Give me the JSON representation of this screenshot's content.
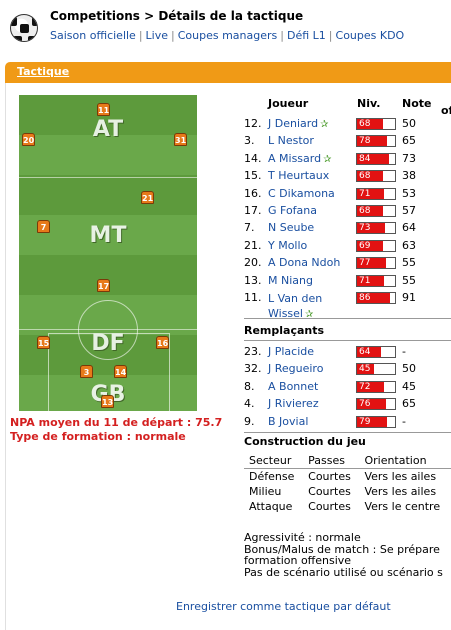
{
  "header": {
    "breadcrumb": "Competitions > Détails de la tactique",
    "nav": [
      "Saison officielle",
      "Live",
      "Coupes managers",
      "Défi L1",
      "Coupes KDO"
    ]
  },
  "tab": {
    "label": "Tactique"
  },
  "pitch": {
    "zones": [
      "AT",
      "MT",
      "DF",
      "GB"
    ],
    "shirts": [
      "11",
      "20",
      "31",
      "21",
      "7",
      "17",
      "15",
      "16",
      "3",
      "14",
      "13"
    ]
  },
  "summary": {
    "npa": "NPA moyen du 11 de départ : 75.7",
    "formation": "Type de formation : normale"
  },
  "table": {
    "headers": {
      "player": "Joueur",
      "level": "Niv.",
      "note": "Note",
      "extra": "of"
    },
    "starters": [
      {
        "num": "12.",
        "name": "J Deniard",
        "star": true,
        "level": 68,
        "note": "50"
      },
      {
        "num": "3.",
        "name": "L Nestor",
        "star": false,
        "level": 78,
        "note": "65"
      },
      {
        "num": "14.",
        "name": "A Missard",
        "star": true,
        "level": 84,
        "note": "73"
      },
      {
        "num": "15.",
        "name": "T Heurtaux",
        "star": false,
        "level": 68,
        "note": "38"
      },
      {
        "num": "16.",
        "name": "C Dikamona",
        "star": false,
        "level": 71,
        "note": "53"
      },
      {
        "num": "17.",
        "name": "G Fofana",
        "star": false,
        "level": 68,
        "note": "57"
      },
      {
        "num": "7.",
        "name": "N Seube",
        "star": false,
        "level": 73,
        "note": "64"
      },
      {
        "num": "21.",
        "name": "Y Mollo",
        "star": false,
        "level": 69,
        "note": "63"
      },
      {
        "num": "20.",
        "name": "A Dona Ndoh",
        "star": false,
        "level": 77,
        "note": "55"
      },
      {
        "num": "13.",
        "name": "M Niang",
        "star": false,
        "level": 71,
        "note": "55"
      },
      {
        "num": "11.",
        "name": "L Van den Wissel",
        "star": true,
        "level": 86,
        "note": "91"
      }
    ],
    "subs_title": "Remplaçants",
    "subs": [
      {
        "num": "23.",
        "name": "J Placide",
        "level": 64,
        "note": "-"
      },
      {
        "num": "32.",
        "name": "J Regueiro",
        "level": 45,
        "note": "50"
      },
      {
        "num": "8.",
        "name": "A Bonnet",
        "level": 72,
        "note": "45"
      },
      {
        "num": "4.",
        "name": "J Rivierez",
        "level": 76,
        "note": "65"
      },
      {
        "num": "9.",
        "name": "B Jovial",
        "level": 79,
        "note": "-"
      }
    ]
  },
  "construction": {
    "title": "Construction du jeu",
    "headers": [
      "Secteur",
      "Passes",
      "Orientation"
    ],
    "rows": [
      [
        "Défense",
        "Courtes",
        "Vers les ailes"
      ],
      [
        "Milieu",
        "Courtes",
        "Vers les ailes"
      ],
      [
        "Attaque",
        "Courtes",
        "Vers le centre"
      ]
    ]
  },
  "infos": {
    "aggressivity": "Agressivité : normale",
    "bonus_line1": "Bonus/Malus de match : Se prépare",
    "bonus_line2": "formation offensive",
    "scenario": "Pas de scénario utilisé ou scénario s"
  },
  "footer": {
    "save_default": "Enregistrer comme tactique par défaut"
  },
  "colors": {
    "accent": "#f09a16",
    "link": "#1a4fa0",
    "bar": "#e21212",
    "alert": "#d42020"
  }
}
